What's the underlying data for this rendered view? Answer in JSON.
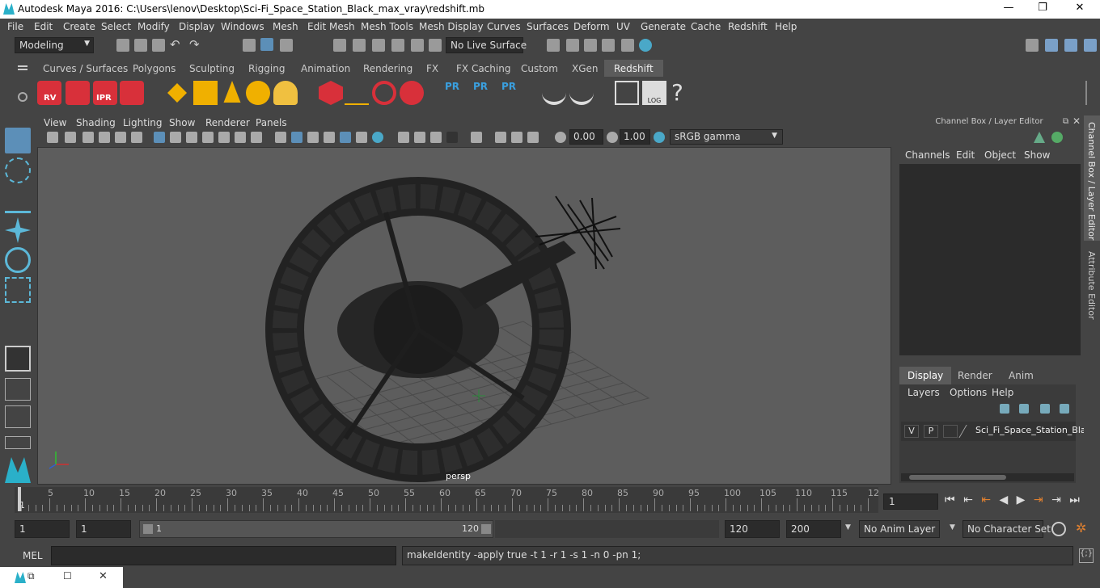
{
  "window": {
    "title": "Autodesk Maya 2016: C:\\Users\\lenov\\Desktop\\Sci-Fi_Space_Station_Black_max_vray\\redshift.mb",
    "minimize": "—",
    "maximize": "❐",
    "close": "✕"
  },
  "menubar": [
    "File",
    "Edit",
    "Create",
    "Select",
    "Modify",
    "Display",
    "Windows",
    "Mesh",
    "Edit Mesh",
    "Mesh Tools",
    "Mesh Display",
    "Curves",
    "Surfaces",
    "Deform",
    "UV",
    "Generate",
    "Cache",
    "Redshift",
    "Help"
  ],
  "status": {
    "mode": "Modeling",
    "live_surface": "No Live Surface"
  },
  "shelf_tabs": [
    "Curves / Surfaces",
    "Polygons",
    "Sculpting",
    "Rigging",
    "Animation",
    "Rendering",
    "FX",
    "FX Caching",
    "Custom",
    "XGen",
    "Redshift"
  ],
  "shelf_labels": {
    "rv": "RV",
    "ipr": "IPR",
    "pr1": "PR",
    "pr2": "PR",
    "pr3": "PR",
    "log": "LOG",
    "help": "?"
  },
  "viewport": {
    "menu": [
      "View",
      "Shading",
      "Lighting",
      "Show",
      "Renderer",
      "Panels"
    ],
    "near": "0.00",
    "far": "1.00",
    "color_space": "sRGB gamma",
    "camera": "persp"
  },
  "channel_box": {
    "title": "Channel Box / Layer Editor",
    "menu": [
      "Channels",
      "Edit",
      "Object",
      "Show"
    ],
    "tabs": [
      "Display",
      "Render",
      "Anim"
    ],
    "layer_menu": [
      "Layers",
      "Options",
      "Help"
    ],
    "layer": {
      "v": "V",
      "p": "P",
      "name": "Sci_Fi_Space_Station_Bla"
    }
  },
  "side_tabs": {
    "channel": "Channel Box / Layer Editor",
    "attribute": "Attribute Editor"
  },
  "timeline": {
    "ticks": [
      "5",
      "10",
      "15",
      "20",
      "25",
      "30",
      "35",
      "40",
      "45",
      "50",
      "55",
      "60",
      "65",
      "70",
      "75",
      "80",
      "85",
      "90",
      "95",
      "100",
      "105",
      "110",
      "115",
      "12"
    ],
    "first": "1",
    "current": "1"
  },
  "range": {
    "start": "1",
    "start2": "1",
    "slider_start": "1",
    "slider_end": "120",
    "end": "120",
    "end2": "200",
    "anim_layer": "No Anim Layer",
    "char_set": "No Character Set"
  },
  "command": {
    "lang": "MEL",
    "input": "",
    "output": "makeIdentity -apply true -t 1 -r 1 -s 1 -n 0 -pn 1;"
  },
  "colors": {
    "accent": "#5b5b5b",
    "redshift": "#e0303a",
    "pr_blue": "#3aa0e0",
    "viewport": "#5d5d5d"
  }
}
